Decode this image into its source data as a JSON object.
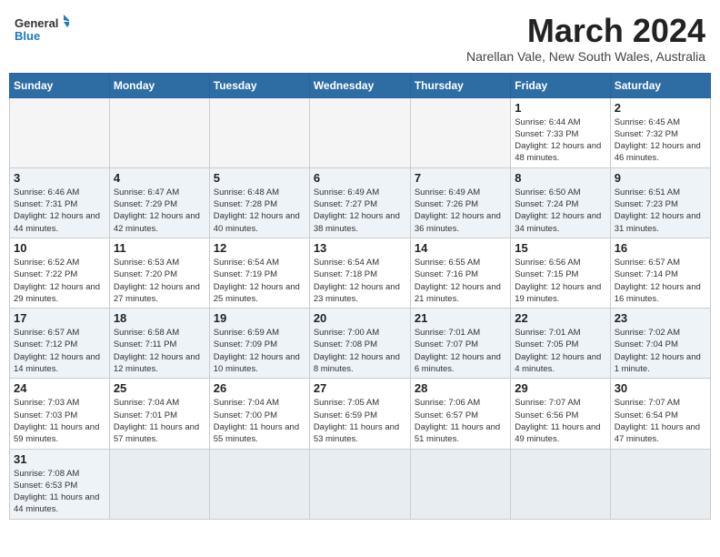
{
  "logo": {
    "line1": "General",
    "line2": "Blue"
  },
  "header": {
    "month": "March 2024",
    "location": "Narellan Vale, New South Wales, Australia"
  },
  "weekdays": [
    "Sunday",
    "Monday",
    "Tuesday",
    "Wednesday",
    "Thursday",
    "Friday",
    "Saturday"
  ],
  "weeks": [
    [
      {
        "day": "",
        "info": ""
      },
      {
        "day": "",
        "info": ""
      },
      {
        "day": "",
        "info": ""
      },
      {
        "day": "",
        "info": ""
      },
      {
        "day": "",
        "info": ""
      },
      {
        "day": "1",
        "info": "Sunrise: 6:44 AM\nSunset: 7:33 PM\nDaylight: 12 hours and 48 minutes."
      },
      {
        "day": "2",
        "info": "Sunrise: 6:45 AM\nSunset: 7:32 PM\nDaylight: 12 hours and 46 minutes."
      }
    ],
    [
      {
        "day": "3",
        "info": "Sunrise: 6:46 AM\nSunset: 7:31 PM\nDaylight: 12 hours and 44 minutes."
      },
      {
        "day": "4",
        "info": "Sunrise: 6:47 AM\nSunset: 7:29 PM\nDaylight: 12 hours and 42 minutes."
      },
      {
        "day": "5",
        "info": "Sunrise: 6:48 AM\nSunset: 7:28 PM\nDaylight: 12 hours and 40 minutes."
      },
      {
        "day": "6",
        "info": "Sunrise: 6:49 AM\nSunset: 7:27 PM\nDaylight: 12 hours and 38 minutes."
      },
      {
        "day": "7",
        "info": "Sunrise: 6:49 AM\nSunset: 7:26 PM\nDaylight: 12 hours and 36 minutes."
      },
      {
        "day": "8",
        "info": "Sunrise: 6:50 AM\nSunset: 7:24 PM\nDaylight: 12 hours and 34 minutes."
      },
      {
        "day": "9",
        "info": "Sunrise: 6:51 AM\nSunset: 7:23 PM\nDaylight: 12 hours and 31 minutes."
      }
    ],
    [
      {
        "day": "10",
        "info": "Sunrise: 6:52 AM\nSunset: 7:22 PM\nDaylight: 12 hours and 29 minutes."
      },
      {
        "day": "11",
        "info": "Sunrise: 6:53 AM\nSunset: 7:20 PM\nDaylight: 12 hours and 27 minutes."
      },
      {
        "day": "12",
        "info": "Sunrise: 6:54 AM\nSunset: 7:19 PM\nDaylight: 12 hours and 25 minutes."
      },
      {
        "day": "13",
        "info": "Sunrise: 6:54 AM\nSunset: 7:18 PM\nDaylight: 12 hours and 23 minutes."
      },
      {
        "day": "14",
        "info": "Sunrise: 6:55 AM\nSunset: 7:16 PM\nDaylight: 12 hours and 21 minutes."
      },
      {
        "day": "15",
        "info": "Sunrise: 6:56 AM\nSunset: 7:15 PM\nDaylight: 12 hours and 19 minutes."
      },
      {
        "day": "16",
        "info": "Sunrise: 6:57 AM\nSunset: 7:14 PM\nDaylight: 12 hours and 16 minutes."
      }
    ],
    [
      {
        "day": "17",
        "info": "Sunrise: 6:57 AM\nSunset: 7:12 PM\nDaylight: 12 hours and 14 minutes."
      },
      {
        "day": "18",
        "info": "Sunrise: 6:58 AM\nSunset: 7:11 PM\nDaylight: 12 hours and 12 minutes."
      },
      {
        "day": "19",
        "info": "Sunrise: 6:59 AM\nSunset: 7:09 PM\nDaylight: 12 hours and 10 minutes."
      },
      {
        "day": "20",
        "info": "Sunrise: 7:00 AM\nSunset: 7:08 PM\nDaylight: 12 hours and 8 minutes."
      },
      {
        "day": "21",
        "info": "Sunrise: 7:01 AM\nSunset: 7:07 PM\nDaylight: 12 hours and 6 minutes."
      },
      {
        "day": "22",
        "info": "Sunrise: 7:01 AM\nSunset: 7:05 PM\nDaylight: 12 hours and 4 minutes."
      },
      {
        "day": "23",
        "info": "Sunrise: 7:02 AM\nSunset: 7:04 PM\nDaylight: 12 hours and 1 minute."
      }
    ],
    [
      {
        "day": "24",
        "info": "Sunrise: 7:03 AM\nSunset: 7:03 PM\nDaylight: 11 hours and 59 minutes."
      },
      {
        "day": "25",
        "info": "Sunrise: 7:04 AM\nSunset: 7:01 PM\nDaylight: 11 hours and 57 minutes."
      },
      {
        "day": "26",
        "info": "Sunrise: 7:04 AM\nSunset: 7:00 PM\nDaylight: 11 hours and 55 minutes."
      },
      {
        "day": "27",
        "info": "Sunrise: 7:05 AM\nSunset: 6:59 PM\nDaylight: 11 hours and 53 minutes."
      },
      {
        "day": "28",
        "info": "Sunrise: 7:06 AM\nSunset: 6:57 PM\nDaylight: 11 hours and 51 minutes."
      },
      {
        "day": "29",
        "info": "Sunrise: 7:07 AM\nSunset: 6:56 PM\nDaylight: 11 hours and 49 minutes."
      },
      {
        "day": "30",
        "info": "Sunrise: 7:07 AM\nSunset: 6:54 PM\nDaylight: 11 hours and 47 minutes."
      }
    ],
    [
      {
        "day": "31",
        "info": "Sunrise: 7:08 AM\nSunset: 6:53 PM\nDaylight: 11 hours and 44 minutes."
      },
      {
        "day": "",
        "info": ""
      },
      {
        "day": "",
        "info": ""
      },
      {
        "day": "",
        "info": ""
      },
      {
        "day": "",
        "info": ""
      },
      {
        "day": "",
        "info": ""
      },
      {
        "day": "",
        "info": ""
      }
    ]
  ]
}
